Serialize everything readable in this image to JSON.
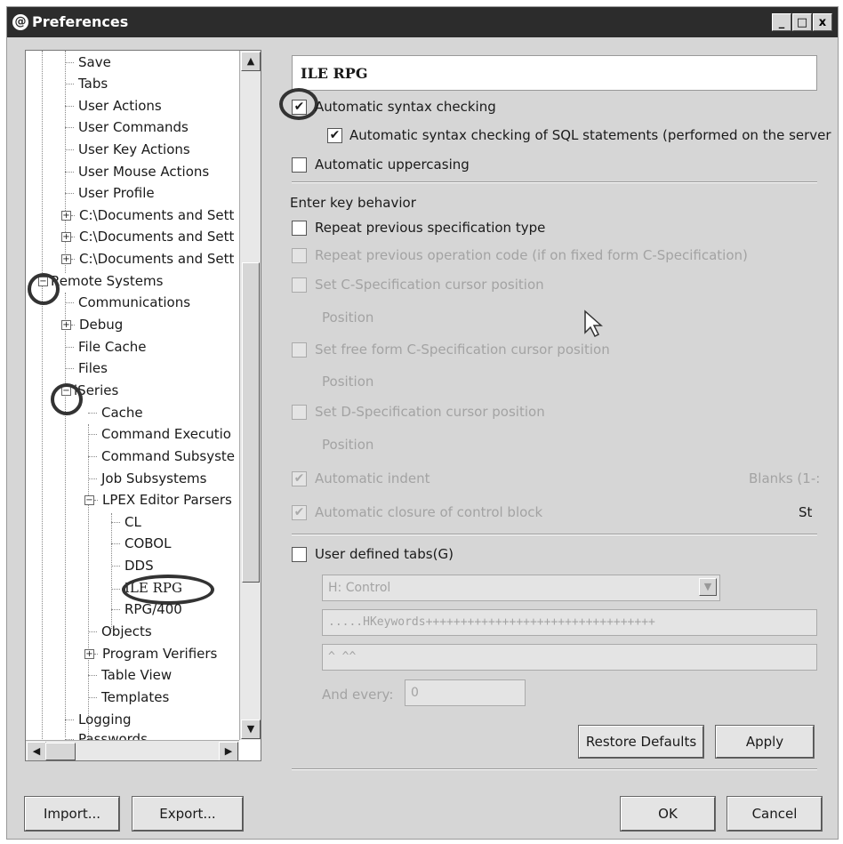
{
  "window": {
    "title": "Preferences",
    "controls": [
      "_",
      "□",
      "x"
    ]
  },
  "tree": {
    "items": [
      {
        "label": "Save"
      },
      {
        "label": "Tabs"
      },
      {
        "label": "User Actions"
      },
      {
        "label": "User Commands"
      },
      {
        "label": "User Key Actions"
      },
      {
        "label": "User Mouse Actions"
      },
      {
        "label": "User Profile"
      },
      {
        "label": "C:\\Documents and Sett"
      },
      {
        "label": "C:\\Documents and Sett"
      },
      {
        "label": "C:\\Documents and Sett"
      },
      {
        "label": "Remote Systems"
      },
      {
        "label": "Communications"
      },
      {
        "label": "Debug"
      },
      {
        "label": "File Cache"
      },
      {
        "label": "Files"
      },
      {
        "label": "iSeries"
      },
      {
        "label": "Cache"
      },
      {
        "label": "Command Executio"
      },
      {
        "label": "Command Subsyste"
      },
      {
        "label": "Job Subsystems"
      },
      {
        "label": "LPEX Editor Parsers"
      },
      {
        "label": "CL"
      },
      {
        "label": "COBOL"
      },
      {
        "label": "DDS"
      },
      {
        "label": "ILE RPG"
      },
      {
        "label": "RPG/400"
      },
      {
        "label": "Objects"
      },
      {
        "label": "Program Verifiers"
      },
      {
        "label": "Table View"
      },
      {
        "label": "Templates"
      },
      {
        "label": "Logging"
      },
      {
        "label": "Passwords"
      }
    ]
  },
  "page": {
    "title": "ILE RPG",
    "auto_syntax": "Automatic syntax checking",
    "auto_syntax_sql": "Automatic syntax checking of SQL statements (performed on the server",
    "auto_uppercase": "Automatic uppercasing",
    "enter_key_heading": "Enter key behavior",
    "repeat_spec": "Repeat previous specification type",
    "repeat_opcode": "Repeat previous operation code (if on fixed form C-Specification)",
    "set_c_cursor": "Set C-Specification cursor position",
    "position1": "Position",
    "set_free_cursor": "Set free form C-Specification cursor position",
    "position2": "Position",
    "set_d_cursor": "Set D-Specification cursor position",
    "position3": "Position",
    "auto_indent": "Automatic indent",
    "blanks": "Blanks (1-:",
    "auto_closure": "Automatic closure of control block",
    "st": "St",
    "user_tabs": "User defined tabs(G)",
    "spec_select": "H: Control",
    "ruler": ".....HKeywords+++++++++++++++++++++++++++++++++",
    "tab_marks": "^      ^^",
    "and_every_label": "And every:",
    "and_every_value": "0",
    "restore_defaults": "Restore Defaults",
    "apply": "Apply"
  },
  "footer": {
    "import": "Import...",
    "export": "Export...",
    "ok": "OK",
    "cancel": "Cancel"
  }
}
